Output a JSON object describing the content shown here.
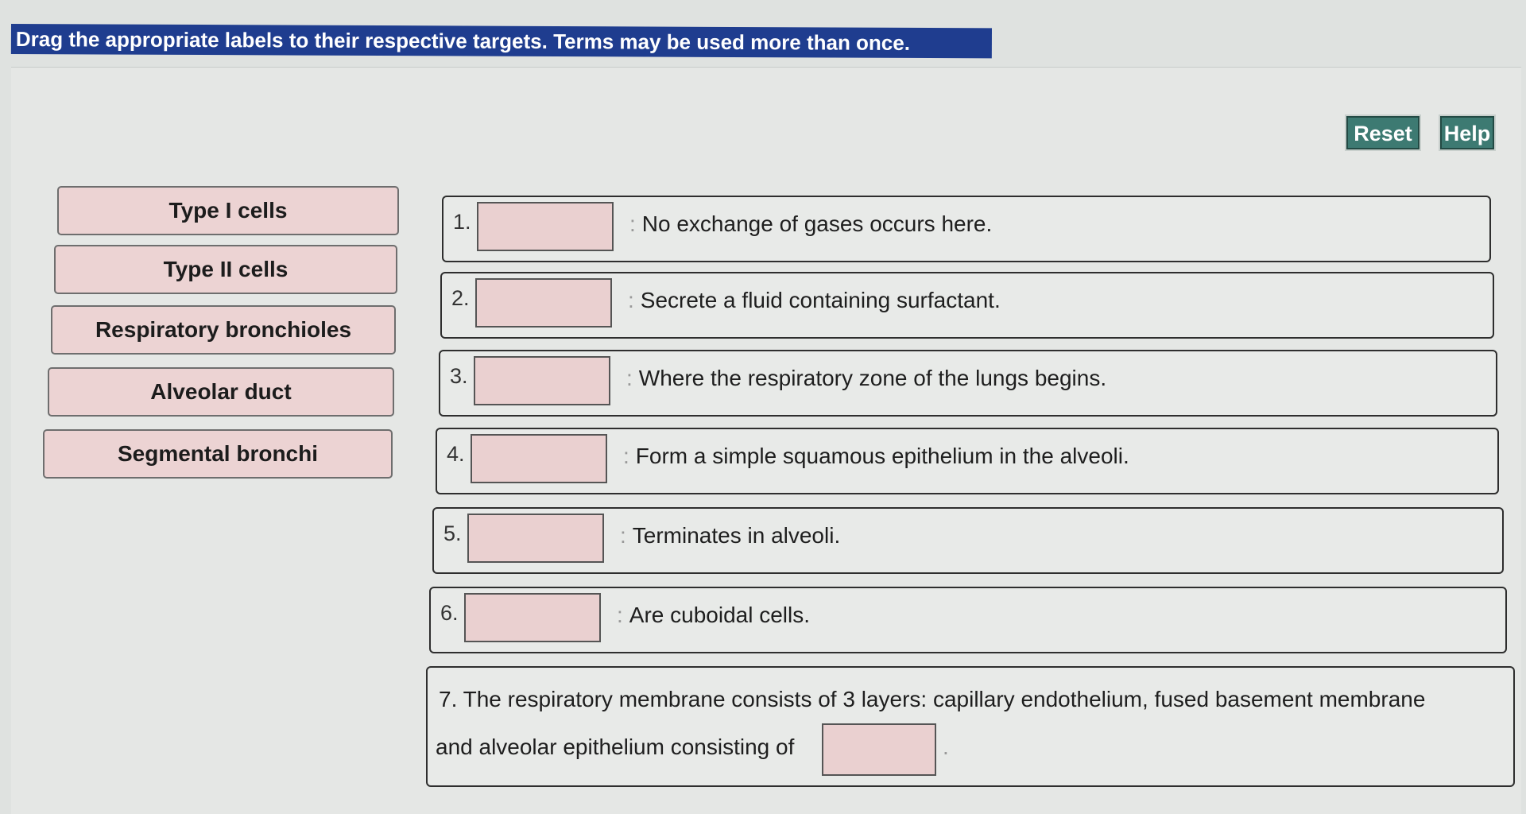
{
  "instruction": "Drag the appropriate labels to their respective targets. Terms may be used more than once.",
  "toolbar": {
    "reset_label": "Reset",
    "help_label": "Help"
  },
  "labels": [
    "Type I cells",
    "Type II cells",
    "Respiratory bronchioles",
    "Alveolar duct",
    "Segmental bronchi"
  ],
  "targets": [
    {
      "num": "1.",
      "text": "No exchange of gases occurs here."
    },
    {
      "num": "2.",
      "text": "Secrete a fluid containing surfactant."
    },
    {
      "num": "3.",
      "text": "Where the respiratory zone of the lungs begins."
    },
    {
      "num": "4.",
      "text": "Form a simple squamous epithelium in the alveoli."
    },
    {
      "num": "5.",
      "text": "Terminates in alveoli."
    },
    {
      "num": "6.",
      "text": "Are cuboidal cells."
    }
  ],
  "target7": {
    "line1": "7. The respiratory membrane consists of 3 layers: capillary endothelium, fused basement membrane",
    "line2": "and alveolar epithelium consisting of"
  },
  "colors": {
    "instruction_bg": "#1f3d8f",
    "button_bg": "#3d7a72",
    "chip_bg": "#ecd3d3",
    "drop_bg": "#ead0d0"
  }
}
